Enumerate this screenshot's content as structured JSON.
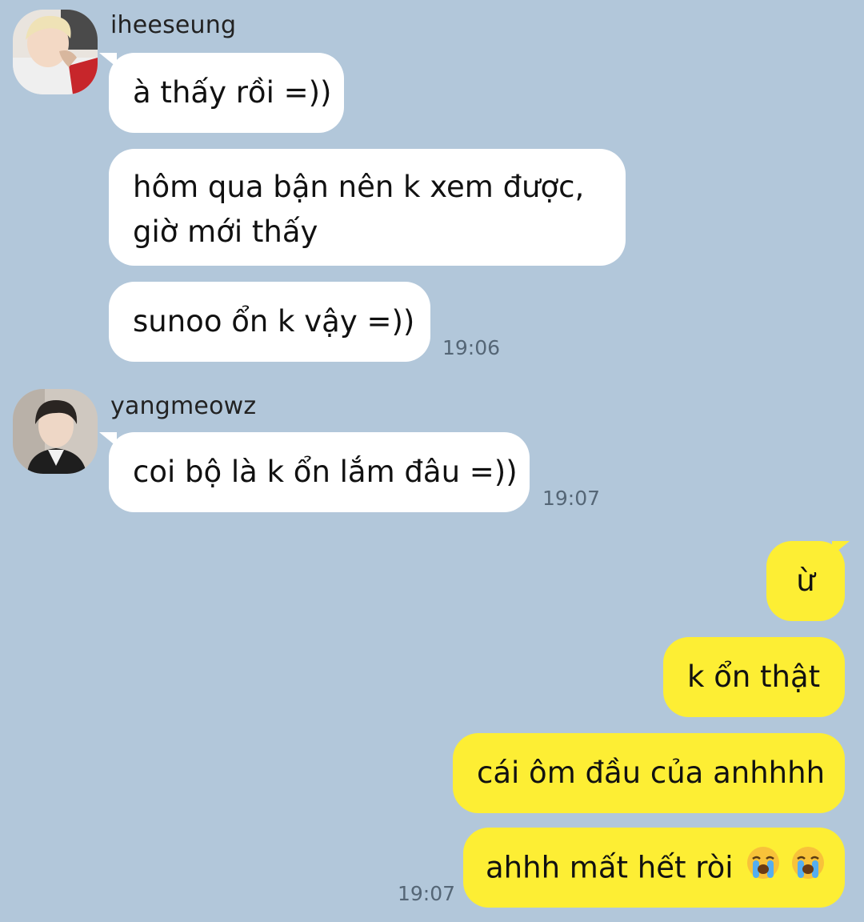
{
  "conversation": {
    "senders": {
      "first": "iheeseung",
      "second": "yangmeowz"
    },
    "messages": {
      "m1": "à thấy rồi =))",
      "m2_line1": "hôm qua bận nên k xem được,",
      "m2_line2": "giờ mới thấy",
      "m3": "sunoo ổn k vậy =))",
      "m4": "coi bộ là k ổn lắm đâu =))",
      "m5": "ừ",
      "m6": "k ổn thật",
      "m7": "cái ôm đầu của anhhhh",
      "m8": "ahhh mất hết ròi"
    },
    "times": {
      "t1": "19:06",
      "t2": "19:07",
      "t3": "19:07"
    }
  },
  "icons": {
    "avatar1": "user-avatar-photo",
    "avatar2": "user-avatar-photo",
    "emoji": "loudly-crying-face-emoji"
  },
  "colors": {
    "background": "#b2c7da",
    "incoming_bubble": "#ffffff",
    "outgoing_bubble": "#fdee34"
  }
}
